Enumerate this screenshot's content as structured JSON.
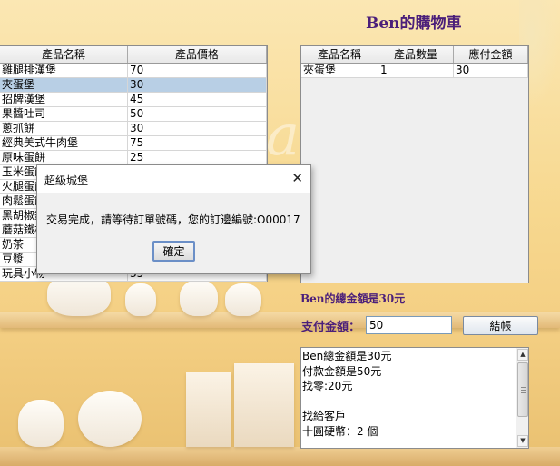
{
  "title": "Ben的購物車",
  "products_table": {
    "headers": [
      "產品名稱",
      "產品價格"
    ],
    "rows": [
      [
        "雞腿排漢堡",
        "70"
      ],
      [
        "夾蛋堡",
        "30"
      ],
      [
        "招牌漢堡",
        "45"
      ],
      [
        "果醬吐司",
        "50"
      ],
      [
        "蔥抓餅",
        "30"
      ],
      [
        "經典美式牛肉堡",
        "75"
      ],
      [
        "原味蛋餅",
        "25"
      ],
      [
        "玉米蛋餅",
        ""
      ],
      [
        "火腿蛋餅",
        ""
      ],
      [
        "肉鬆蛋餅",
        ""
      ],
      [
        "黑胡椒鐵板麵",
        ""
      ],
      [
        "蘑菇鐵板麵",
        ""
      ],
      [
        "奶茶",
        ""
      ],
      [
        "豆漿",
        ""
      ],
      [
        "玩具小物",
        "35"
      ]
    ],
    "selected_index": 1
  },
  "cart_table": {
    "headers": [
      "產品名稱",
      "產品數量",
      "應付金額"
    ],
    "rows": [
      [
        "夾蛋堡",
        "1",
        "30"
      ]
    ]
  },
  "total_text": "Ben的總金額是30元",
  "payment": {
    "label": "支付金額：",
    "value": "50",
    "button_label": "結帳"
  },
  "receipt_text": "Ben總金額是30元\n付款金額是50元\n找零:20元\n-------------------------\n找給客戶\n十圓硬幣：2 個",
  "dialog": {
    "title": "超級城堡",
    "message": "交易完成，請等待訂單號碼，您的訂邊編號:O00017",
    "ok_label": "確定",
    "close_glyph": "✕"
  },
  "scrollbar": {
    "up": "▲",
    "down": "▼"
  },
  "colors": {
    "accent_text": "#4b1f7a",
    "selection": "#b8cfe5"
  }
}
